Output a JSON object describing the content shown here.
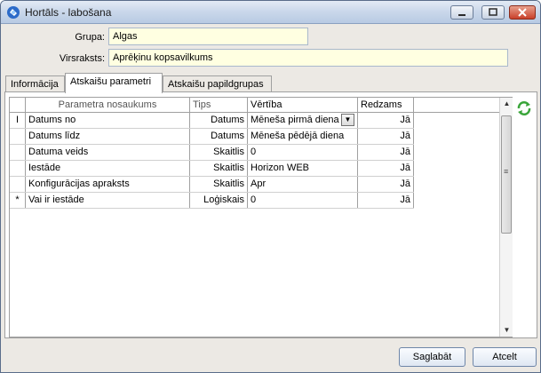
{
  "window": {
    "title": "Hortāls - labošana",
    "buttons": {
      "minimize": "minimize",
      "maximize": "maximize",
      "close": "close"
    }
  },
  "form": {
    "group_label": "Grupa:",
    "group_value": "Algas",
    "heading_label": "Virsraksts:",
    "heading_value": "Aprēķinu kopsavilkums"
  },
  "tabs": [
    {
      "label": "Informācija",
      "active": false
    },
    {
      "label": "Atskaišu parametri",
      "active": true
    },
    {
      "label": "Atskaišu papildgrupas",
      "active": false
    }
  ],
  "grid": {
    "columns": [
      "Parametra nosaukums",
      "Tips",
      "Vērtība",
      "Redzams"
    ],
    "rows": [
      {
        "marker": "I",
        "name": "Datums no",
        "type": "Datums",
        "value": "Mēneša pirmā diena",
        "visible": "Jā"
      },
      {
        "marker": "",
        "name": "Datums līdz",
        "type": "Datums",
        "value": "Mēneša pēdējā diena",
        "visible": "Jā"
      },
      {
        "marker": "",
        "name": "Datuma veids",
        "type": "Skaitlis",
        "value": "0",
        "visible": "Jā"
      },
      {
        "marker": "",
        "name": "Iestāde",
        "type": "Skaitlis",
        "value": "Horizon WEB",
        "visible": "Jā"
      },
      {
        "marker": "",
        "name": "Konfigurācijas apraksts",
        "type": "Skaitlis",
        "value": "Apr",
        "visible": "Jā"
      },
      {
        "marker": "*",
        "name": "Vai ir iestāde",
        "type": "Loģiskais",
        "value": "0",
        "visible": "Jā"
      }
    ]
  },
  "actions": {
    "save_label": "Saglabāt",
    "cancel_label": "Atcelt"
  },
  "colors": {
    "input_bg": "#ffffe1",
    "refresh_icon": "#3aa53a",
    "app_icon": "#2c6bc9"
  }
}
